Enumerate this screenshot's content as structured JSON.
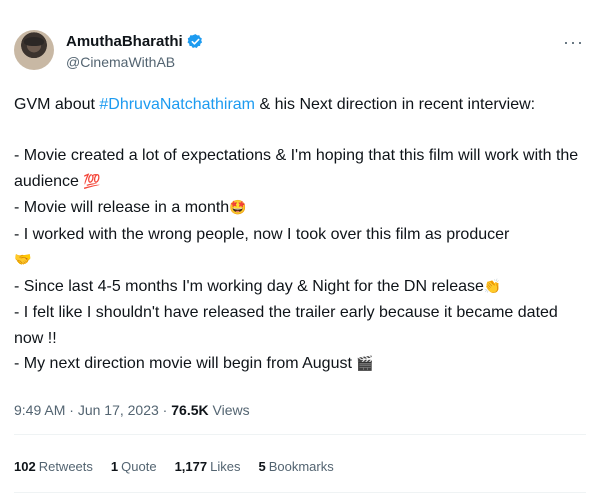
{
  "author": {
    "name": "AmuthaBharathi",
    "handle": "@CinemaWithAB",
    "verified_color": "#1d9bf0"
  },
  "tweet": {
    "intro_pre": "GVM about ",
    "hashtag": "#DhruvaNatchathiram",
    "intro_post": " & his Next direction in recent interview:",
    "line1": "- Movie created a lot of expectations & I'm hoping that this film will work with the audience",
    "line1_emoji": "💯",
    "line2": "- Movie will release in a month",
    "line2_emoji": "🤩",
    "line3": "- I worked with the wrong people, now I took over this film as producer",
    "line3_emoji": "🤝",
    "line4": "- Since last 4-5 months I'm working day & Night for the DN release",
    "line4_emoji": "👏",
    "line5": "- I felt like I shouldn't have released the trailer early because it became dated now !!",
    "line6": "- My next direction movie will begin from August",
    "line6_emoji": "🎬"
  },
  "meta": {
    "time": "9:49 AM",
    "sep1": " · ",
    "date": "Jun 17, 2023",
    "sep2": " · ",
    "views_count": "76.5K",
    "views_label": " Views"
  },
  "stats": {
    "retweets_count": "102",
    "retweets_label": "Retweets",
    "quotes_count": "1",
    "quotes_label": "Quote",
    "likes_count": "1,177",
    "likes_label": "Likes",
    "bookmarks_count": "5",
    "bookmarks_label": "Bookmarks"
  },
  "icons": {
    "more": "more-options-icon",
    "verified": "verified-badge-icon"
  }
}
